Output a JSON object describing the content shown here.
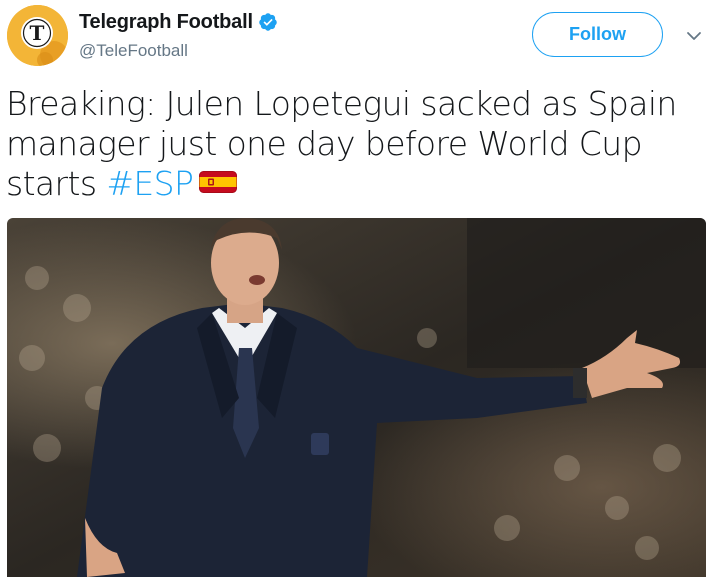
{
  "account": {
    "display_name": "Telegraph Football",
    "handle": "@TeleFootball",
    "verified": true,
    "avatar_icon": "telegraph-t-logo"
  },
  "actions": {
    "follow_label": "Follow",
    "menu_icon": "chevron-down-icon"
  },
  "tweet": {
    "text_line1": "Breaking: Julen Lopetegui sacked as Spain",
    "text_line2": "manager just one day before World Cup",
    "text_line3": "starts",
    "hashtag": "#ESP",
    "emoji": "spain-flag"
  },
  "media": {
    "type": "photo",
    "subject": "man in navy suit gesturing in stadium"
  },
  "colors": {
    "accent": "#1da1f2",
    "text": "#14171a",
    "secondary": "#657786"
  }
}
